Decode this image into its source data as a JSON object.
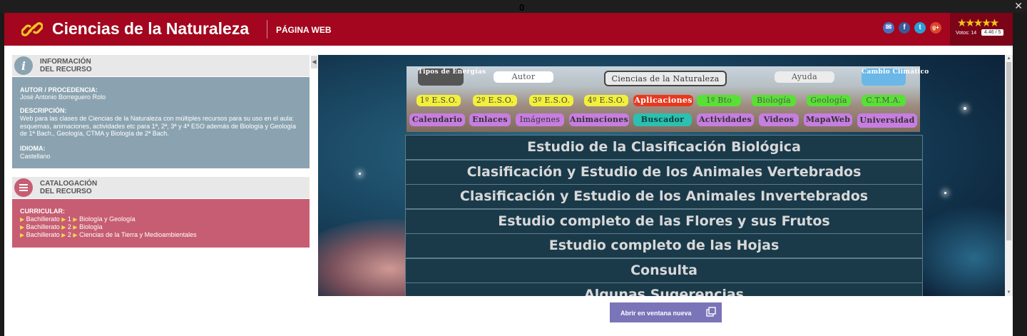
{
  "topbar": {
    "glyph": "0",
    "close_label": "✕"
  },
  "header": {
    "title": "Ciencias de la Naturaleza",
    "type_label": "PÁGINA WEB",
    "social": [
      {
        "name": "email",
        "glyph": "✉",
        "color": "#4a6fc1"
      },
      {
        "name": "facebook",
        "glyph": "f",
        "color": "#3b5998"
      },
      {
        "name": "twitter",
        "glyph": "t",
        "color": "#2a9fd8"
      },
      {
        "name": "google-plus",
        "glyph": "g+",
        "color": "#d9482b"
      }
    ],
    "rating": {
      "stars": 4.46,
      "stars_glyph": "★★★★★",
      "votes_label": "Votos: 14",
      "score_label": "4.46 / 5"
    }
  },
  "info": {
    "heading_line1": "INFORMACIÓN",
    "heading_line2": "DEL RECURSO",
    "author_label": "AUTOR / PROCEDENCIA:",
    "author_value": "José Antonio Borreguero Rolo",
    "description_label": "DESCRIPCIÓN:",
    "description_value": "Web para las clases de Ciencias de la Naturaleza con múltiples recursos para su uso en el aula: esquemas, animaciones, actividades etc para 1ª, 2ª, 3ª y 4ª ESO además de Biología y Geología de 1ª Bach., Geología, CTMA y Biología de 2ª Bach.",
    "language_label": "IDIOMA:",
    "language_value": "Castellano"
  },
  "catalog": {
    "heading_line1": "CATALOGACIÓN",
    "heading_line2": "DEL RECURSO",
    "curricular_label": "CURRICULAR:",
    "items": [
      {
        "level": "Bachillerato",
        "course": "1",
        "subject": "Biología y Geología"
      },
      {
        "level": "Bachillerato",
        "course": "2",
        "subject": "Biología"
      },
      {
        "level": "Bachillerato",
        "course": "2",
        "subject": "Ciencias de la Tierra y Medioambientales"
      }
    ]
  },
  "viewer": {
    "top_nav": [
      "Tipos de Energías",
      "Autor",
      "Ciencias de la Naturaleza",
      "Ayuda",
      "Cambio Climático"
    ],
    "course_nav": [
      "1º E.S.O.",
      "2º E.S.O.",
      "3º E.S.O.",
      "4º E.S.O.",
      "Aplicaciones",
      "1º Bto",
      "Biología",
      "Geología",
      "C.T.M.A."
    ],
    "section_nav": [
      "Calendario",
      "Enlaces",
      "Imágenes",
      "Animaciones",
      "Buscador",
      "Actividades",
      "Videos",
      "MapaWeb",
      "Universidad"
    ],
    "menu": [
      "Estudio de la Clasificación Biológica",
      "Clasificación y Estudio de los Animales Vertebrados",
      "Clasificación y Estudio de los Animales Invertebrados",
      "Estudio completo de las Flores y sus Frutos",
      "Estudio completo de las Hojas",
      "Consulta",
      "Algunas Sugerencias"
    ]
  },
  "open_button": {
    "label": "Abrir en ventana nueva"
  },
  "colors": {
    "header": "#a3061e",
    "info_panel": "#8ba3b0",
    "catalog_panel": "#c75d72",
    "button": "#7a74b8"
  }
}
